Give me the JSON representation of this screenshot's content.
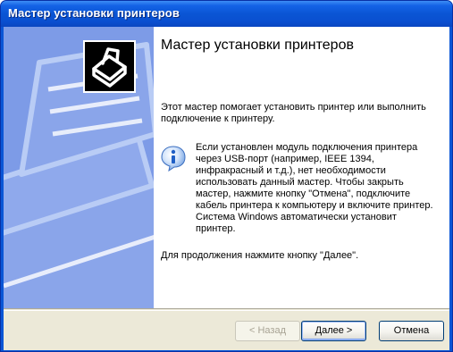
{
  "window": {
    "title": "Мастер установки принтеров"
  },
  "page": {
    "heading": "Мастер установки принтеров",
    "intro": "Этот мастер помогает установить принтер или выполнить подключение к принтеру.",
    "info": "Если установлен модуль подключения принтера через USB-порт (например, IEEE 1394, инфракрасный и т.д.), нет необходимости использовать данный мастер. Чтобы закрыть мастер, нажмите кнопку \"Отмена\", подключите кабель принтера к компьютеру и включите принтер. Система Windows автоматически установит принтер.",
    "continue": "Для продолжения нажмите кнопку \"Далее\"."
  },
  "buttons": {
    "back": "< Назад",
    "next": "Далее >",
    "cancel": "Отмена"
  },
  "icons": {
    "wizard": "printer-wizard-icon",
    "info": "info-icon",
    "watermark": "printer-watermark"
  },
  "colors": {
    "titlebar": "#0a55d4",
    "sidebar": "#7d9be7",
    "footer": "#ece9d8"
  }
}
